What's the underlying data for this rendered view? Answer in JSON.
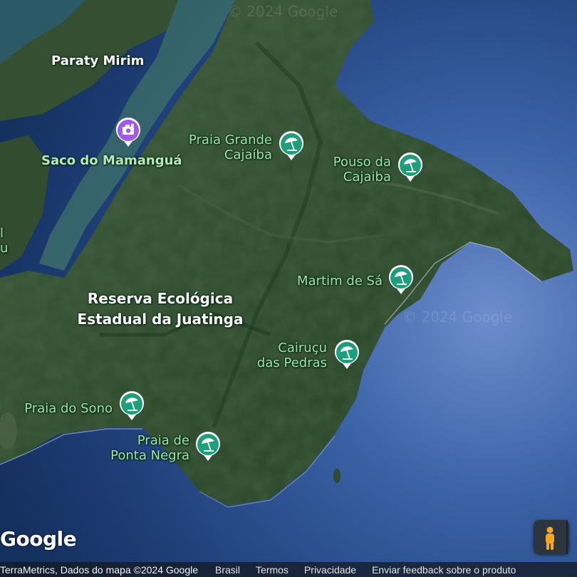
{
  "map": {
    "places": [
      {
        "id": "paraty-mirim",
        "name": "Paraty Mirim"
      },
      {
        "id": "reserva",
        "name": "Reserva Ecológica Estadual da Juatinga"
      }
    ],
    "pins": [
      {
        "id": "saco-do-mamangua",
        "name": "Saco do Mamanguá",
        "type": "photo"
      },
      {
        "id": "praia-grande-cajaiba",
        "name": "Praia Grande Cajaíba",
        "type": "beach"
      },
      {
        "id": "pouso-da-cajaiba",
        "name": "Pouso da Cajaiba",
        "type": "beach"
      },
      {
        "id": "martim-de-sa",
        "name": "Martim de Sá",
        "type": "beach"
      },
      {
        "id": "cairucu-das-pedras",
        "name": "Cairuçu das Pedras",
        "type": "beach"
      },
      {
        "id": "praia-do-sono",
        "name": "Praia do Sono",
        "type": "beach"
      },
      {
        "id": "praia-de-ponta-negra",
        "name": "Praia de Ponta Negra",
        "type": "beach"
      }
    ],
    "labels": {
      "paraty_mirim": "Paraty Mirim",
      "saco": "Saco do Mamanguá",
      "pgc_1": "Praia Grande",
      "pgc_2": "Cajaíba",
      "pdc_1": "Pouso da",
      "pdc_2": "Cajaiba",
      "martim": "Martim de Sá",
      "cairucu_1": "Cairuçu",
      "cairucu_2": "das Pedras",
      "reserva_1": "Reserva Ecológica",
      "reserva_2": "Estadual da Juatinga",
      "sono": "Praia do Sono",
      "ponta_1": "Praia de",
      "ponta_2": "Ponta Negra",
      "edge_1": "l",
      "edge_2": "u"
    },
    "watermarks": [
      "© 2024 Google",
      "© 2024 Google"
    ],
    "colors": {
      "beach_pin": "#1e9e7a",
      "photo_pin": "#a259e6",
      "label_green": "#9ee0a9",
      "ocean": "#2a4f86",
      "forest": "#2f4f2e"
    }
  },
  "logo": "Google",
  "footer": {
    "credit": "TerraMetrics, Dados do mapa ©2024 Google",
    "country": "Brasil",
    "terms": "Termos",
    "privacy": "Privacidade",
    "feedback": "Enviar feedback sobre o produto"
  },
  "controls": {
    "pegman_icon": "pegman-icon"
  }
}
